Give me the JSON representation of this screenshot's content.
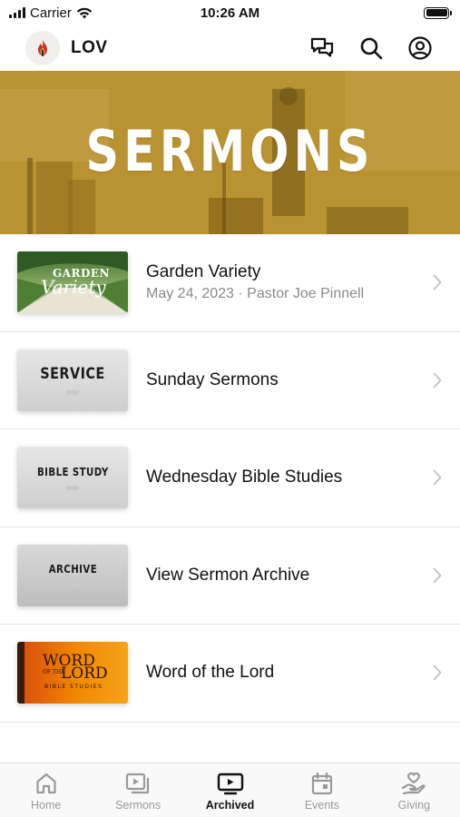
{
  "status": {
    "carrier": "Carrier",
    "time": "10:26 AM",
    "battery_level": 1.0
  },
  "header": {
    "title": "LOV",
    "icons": [
      "chat-icon",
      "search-icon",
      "account-icon"
    ]
  },
  "hero": {
    "title": "SERMONS"
  },
  "list": [
    {
      "title": "Garden Variety",
      "subtitle": "May 24, 2023 · Pastor Joe Pinnell",
      "thumb": {
        "line1": "GARDEN",
        "line2": "Variety"
      }
    },
    {
      "title": "Sunday Sermons",
      "thumb": {
        "label": "SERVICE"
      }
    },
    {
      "title": "Wednesday Bible Studies",
      "thumb": {
        "label": "BIBLE STUDY"
      }
    },
    {
      "title": "View Sermon Archive",
      "thumb": {
        "label": "ARCHIVE"
      }
    },
    {
      "title": "Word of the Lord",
      "thumb": {
        "line1": "WORD",
        "line2": "OF THE",
        "line3": "LORD",
        "line4": "BIBLE STUDIES"
      }
    }
  ],
  "tabs": [
    {
      "label": "Home",
      "icon": "home-icon",
      "active": false
    },
    {
      "label": "Sermons",
      "icon": "sermons-icon",
      "active": false
    },
    {
      "label": "Archived",
      "icon": "tv-icon",
      "active": true
    },
    {
      "label": "Events",
      "icon": "calendar-icon",
      "active": false
    },
    {
      "label": "Giving",
      "icon": "giving-icon",
      "active": false
    }
  ],
  "colors": {
    "hero_gold": "#b8902c",
    "tab_active": "#111111",
    "tab_inactive": "#9a9a9a",
    "word_orange": "#f08a00"
  }
}
